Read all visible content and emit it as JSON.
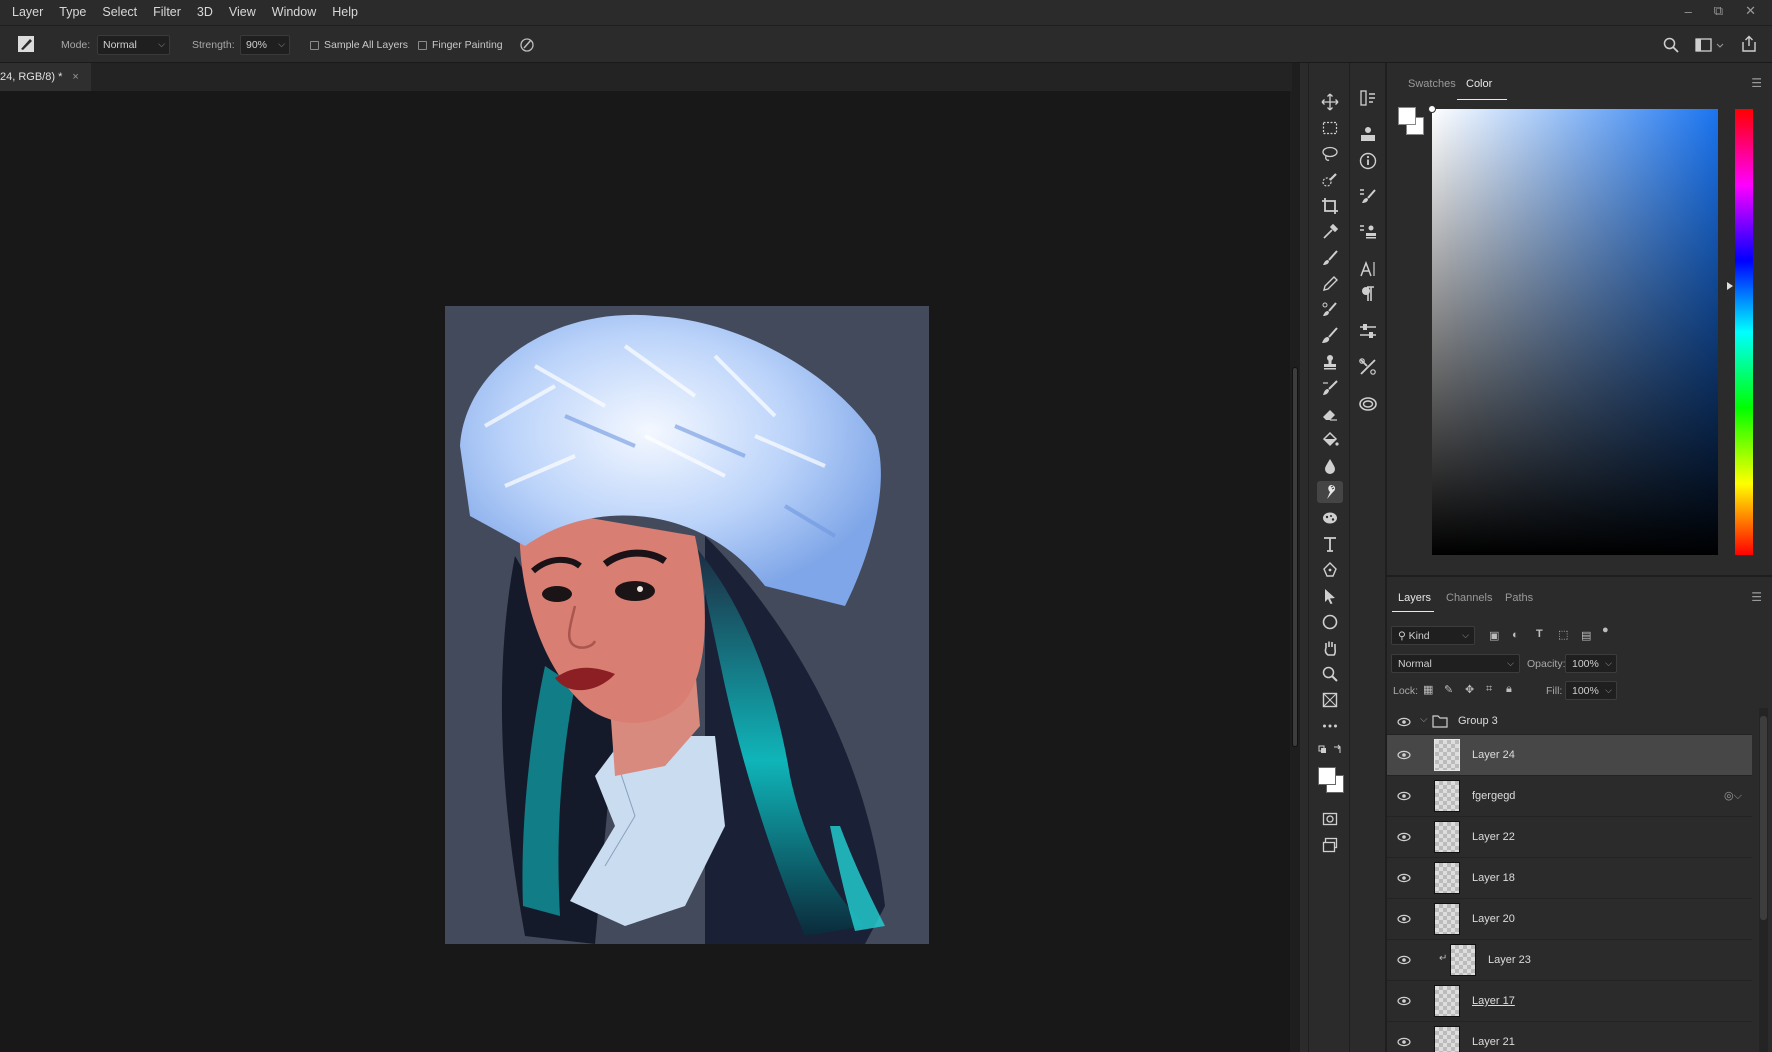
{
  "menu": [
    "Layer",
    "Type",
    "Select",
    "Filter",
    "3D",
    "View",
    "Window",
    "Help"
  ],
  "window_controls": {
    "minimize": "–",
    "restore": "⧉",
    "close": "✕"
  },
  "options": {
    "mode_label": "Mode:",
    "mode_value": "Normal",
    "strength_label": "Strength:",
    "strength_value": "90%",
    "sample_all_layers": "Sample All Layers",
    "finger_painting": "Finger Painting"
  },
  "document_tab": {
    "title": "24, RGB/8) *",
    "close": "×"
  },
  "color_panel": {
    "tabs": [
      "Swatches",
      "Color"
    ],
    "active_tab": "Color",
    "foreground": "#ffffff",
    "background": "#ffffff",
    "hue_color": "#1a74f0"
  },
  "layers_panel": {
    "tabs": [
      "Layers",
      "Channels",
      "Paths"
    ],
    "active_tab": "Layers",
    "filter_kind": "Kind",
    "blend_mode": "Normal",
    "opacity_label": "Opacity:",
    "opacity_value": "100%",
    "lock_label": "Lock:",
    "fill_label": "Fill:",
    "fill_value": "100%",
    "group": "Group 3",
    "layers": [
      {
        "name": "Layer 24",
        "selected": true
      },
      {
        "name": "fgergegd",
        "selected": false
      },
      {
        "name": "Layer 22",
        "selected": false
      },
      {
        "name": "Layer 18",
        "selected": false
      },
      {
        "name": "Layer 20",
        "selected": false
      },
      {
        "name": "Layer 23",
        "selected": false
      },
      {
        "name": "Layer 17",
        "selected": false
      },
      {
        "name": "Layer 21",
        "selected": false
      }
    ]
  }
}
